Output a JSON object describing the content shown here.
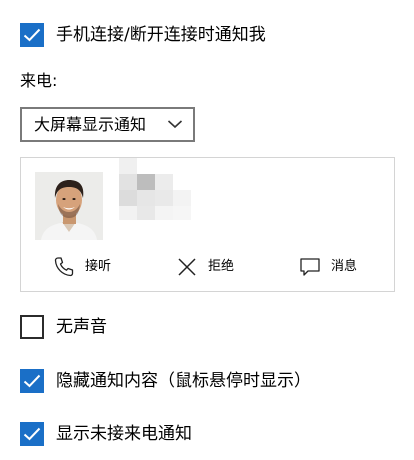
{
  "settings": {
    "notify_on_connect": {
      "label": "手机连接/断开连接时通知我",
      "checked": true
    },
    "incoming_call_label": "来电:",
    "incoming_call_dropdown": {
      "selected": "大屏幕显示通知"
    },
    "silent": {
      "label": "无声音",
      "checked": false
    },
    "hide_content": {
      "label": "隐藏通知内容（鼠标悬停时显示）",
      "checked": true
    },
    "missed_call": {
      "label": "显示未接来电通知",
      "checked": true
    }
  },
  "preview": {
    "actions": [
      {
        "label": "接听",
        "icon": "phone-icon"
      },
      {
        "label": "拒绝",
        "icon": "close-icon"
      },
      {
        "label": "消息",
        "icon": "message-icon"
      }
    ]
  },
  "colors": {
    "accent": "#1a6fc7",
    "border": "#7a7a7a",
    "card_border": "#d4d4d4"
  }
}
